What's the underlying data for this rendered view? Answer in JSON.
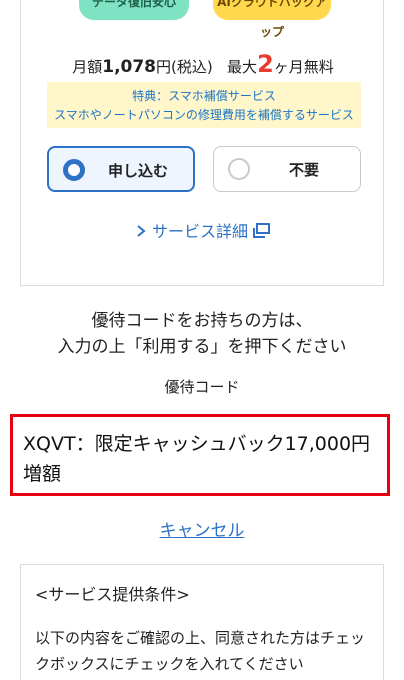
{
  "badges": {
    "green": "データ復旧安心",
    "yellow": "AIクラウドバックアップ"
  },
  "price": {
    "prefix": "月額",
    "amount": "1,078",
    "suffix": "円(税込)",
    "free_prefix": "最大",
    "free_months": "2",
    "free_suffix": "ヶ月無料"
  },
  "perk": {
    "line1": "特典：スマホ補償サービス",
    "line2": "スマホやノートパソコンの修理費用を補償するサービス"
  },
  "options": [
    {
      "label": "申し込む",
      "selected": true
    },
    {
      "label": "不要",
      "selected": false
    }
  ],
  "detail_link": "サービス詳細",
  "instruction": {
    "line1": "優待コードをお持ちの方は、",
    "line2": "入力の上「利用する」を押下ください"
  },
  "code_label": "優待コード",
  "code_value": {
    "line1": "XQVT：限定キャッシュバック17,000円",
    "line2": "増額"
  },
  "cancel_link": "キャンセル",
  "conditions": {
    "title": "<サービス提供条件>",
    "text": "以下の内容をご確認の上、同意された方はチェックボックスにチェックを入れてください"
  },
  "colors": {
    "accent": "#2d72c6",
    "highlight_border": "#e60012",
    "price_red": "#e73c2f"
  }
}
